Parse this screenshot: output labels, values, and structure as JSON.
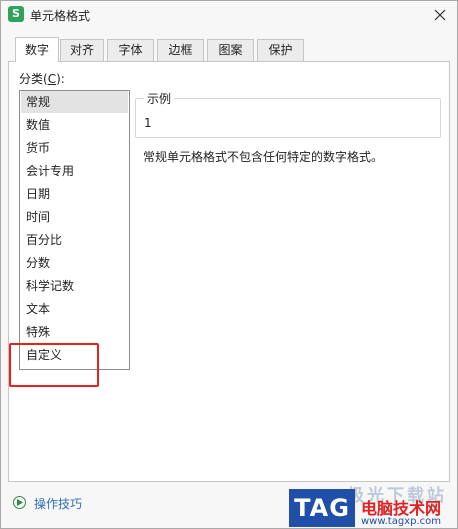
{
  "window": {
    "title": "单元格格式",
    "app_icon": "S"
  },
  "tabs": [
    {
      "label": "数字",
      "active": true
    },
    {
      "label": "对齐",
      "active": false
    },
    {
      "label": "字体",
      "active": false
    },
    {
      "label": "边框",
      "active": false
    },
    {
      "label": "图案",
      "active": false
    },
    {
      "label": "保护",
      "active": false
    }
  ],
  "category": {
    "label": "分类(",
    "accel": "C",
    "label_suffix": "):",
    "items": [
      "常规",
      "数值",
      "货币",
      "会计专用",
      "日期",
      "时间",
      "百分比",
      "分数",
      "科学记数",
      "文本",
      "特殊",
      "自定义"
    ],
    "selected": "常规"
  },
  "sample": {
    "legend": "示例",
    "value": "1"
  },
  "description": "常规单元格格式不包含任何特定的数字格式。",
  "footer": {
    "tips_label": "操作技巧"
  },
  "watermark": {
    "tag": "TAG",
    "faded": "极光下载站",
    "title": "电脑技术网",
    "url": "www.tagxp.com"
  },
  "colors": {
    "highlight": "#e8211f",
    "app_icon": "#2fa35a",
    "link": "#2f6fb8"
  }
}
